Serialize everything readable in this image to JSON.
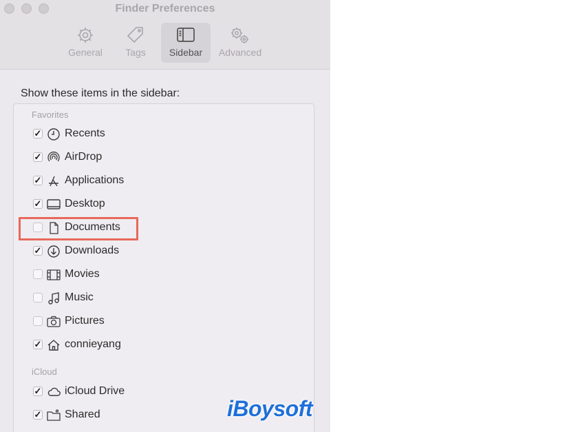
{
  "window": {
    "title": "Finder Preferences"
  },
  "tabs": [
    {
      "label": "General",
      "icon": "gear-icon"
    },
    {
      "label": "Tags",
      "icon": "tag-icon"
    },
    {
      "label": "Sidebar",
      "icon": "sidebar-icon",
      "active": true
    },
    {
      "label": "Advanced",
      "icon": "gears-icon"
    }
  ],
  "heading": "Show these items in the sidebar:",
  "sections": {
    "favorites": {
      "label": "Favorites",
      "items": [
        {
          "label": "Recents",
          "checked": true,
          "icon": "clock-icon"
        },
        {
          "label": "AirDrop",
          "checked": true,
          "icon": "airdrop-icon"
        },
        {
          "label": "Applications",
          "checked": true,
          "icon": "applications-icon"
        },
        {
          "label": "Desktop",
          "checked": true,
          "icon": "desktop-icon"
        },
        {
          "label": "Documents",
          "checked": false,
          "icon": "document-icon"
        },
        {
          "label": "Downloads",
          "checked": true,
          "icon": "download-icon"
        },
        {
          "label": "Movies",
          "checked": false,
          "icon": "film-icon"
        },
        {
          "label": "Music",
          "checked": false,
          "icon": "music-note-icon"
        },
        {
          "label": "Pictures",
          "checked": false,
          "icon": "camera-icon"
        },
        {
          "label": "connieyang",
          "checked": true,
          "icon": "home-icon"
        }
      ]
    },
    "icloud": {
      "label": "iCloud",
      "items": [
        {
          "label": "iCloud Drive",
          "checked": true,
          "icon": "cloud-icon"
        },
        {
          "label": "Shared",
          "checked": true,
          "icon": "shared-folder-icon"
        }
      ]
    }
  },
  "watermark": "iBoysoft",
  "colors": {
    "highlight": "#e8685c",
    "watermark": "#1e6fd9",
    "window_bg": "#ece9ee"
  }
}
